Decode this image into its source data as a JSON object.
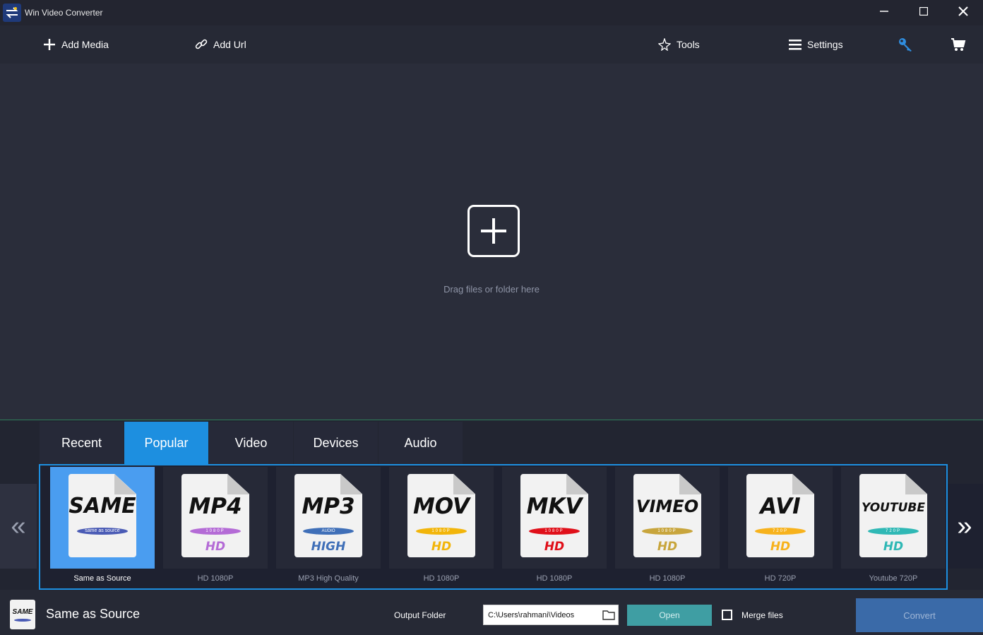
{
  "app": {
    "title": "Win Video Converter"
  },
  "toolbar": {
    "add_media": "Add Media",
    "add_url": "Add Url",
    "tools": "Tools",
    "settings": "Settings"
  },
  "dropzone": {
    "hint": "Drag files or folder here"
  },
  "tabs": [
    {
      "label": "Recent",
      "active": false
    },
    {
      "label": "Popular",
      "active": true
    },
    {
      "label": "Video",
      "active": false
    },
    {
      "label": "Devices",
      "active": false
    },
    {
      "label": "Audio",
      "active": false
    }
  ],
  "formats": [
    {
      "big": "SAME",
      "pill": "same as source",
      "sub": "",
      "caption": "Same as Source",
      "pill_color": "#4a5bb5",
      "sub_color": "",
      "selected": true
    },
    {
      "big": "MP4",
      "pill": "1080P",
      "sub": "HD",
      "caption": "HD 1080P",
      "pill_color": "#b46bd6",
      "sub_color": "#b46bd6",
      "selected": false
    },
    {
      "big": "MP3",
      "pill": "AUDIO",
      "sub": "HIGH",
      "caption": "MP3 High Quality",
      "pill_color": "#3f6fb8",
      "sub_color": "#3f6fb8",
      "selected": false
    },
    {
      "big": "MOV",
      "pill": "1080P",
      "sub": "HD",
      "caption": "HD 1080P",
      "pill_color": "#f2b50a",
      "sub_color": "#f2b50a",
      "selected": false
    },
    {
      "big": "MKV",
      "pill": "1080P",
      "sub": "HD",
      "caption": "HD 1080P",
      "pill_color": "#e0101a",
      "sub_color": "#e0101a",
      "selected": false
    },
    {
      "big": "VIMEO",
      "pill": "1080P",
      "sub": "HD",
      "caption": "HD 1080P",
      "pill_color": "#c8a53c",
      "sub_color": "#c8a53c",
      "selected": false
    },
    {
      "big": "AVI",
      "pill": "720P",
      "sub": "HD",
      "caption": "HD 720P",
      "pill_color": "#f7b21c",
      "sub_color": "#f7b21c",
      "selected": false
    },
    {
      "big": "YOUTUBE",
      "pill": "720P",
      "sub": "HD",
      "caption": "Youtube 720P",
      "pill_color": "#2fb8b5",
      "sub_color": "#2fb8b5",
      "selected": false
    }
  ],
  "footer": {
    "selected_icon_text": "SAME",
    "selected_name": "Same as Source",
    "output_label": "Output Folder",
    "output_path": "C:\\Users\\rahmani\\Videos",
    "open_label": "Open",
    "merge_label": "Merge files",
    "merge_checked": false,
    "convert_label": "Convert"
  },
  "colors": {
    "accent": "#1d8fe0",
    "background": "#2a2d3a",
    "open_button": "#3f9ea3",
    "convert_button": "#3a6aa8"
  }
}
